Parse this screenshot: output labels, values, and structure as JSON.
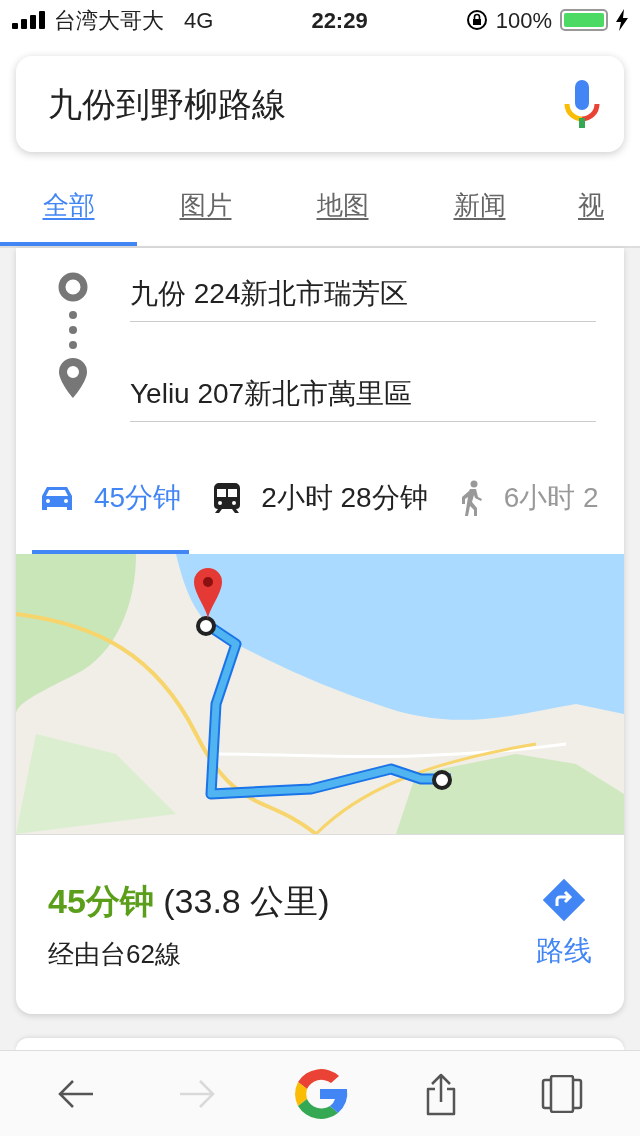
{
  "status_bar": {
    "carrier": "台湾大哥大",
    "network": "4G",
    "time": "22:29",
    "battery": "100%"
  },
  "search": {
    "value": "九份到野柳路線"
  },
  "tabs": [
    {
      "label": "全部",
      "selected": true
    },
    {
      "label": "图片",
      "selected": false
    },
    {
      "label": "地图",
      "selected": false
    },
    {
      "label": "新闻",
      "selected": false
    },
    {
      "label": "视",
      "selected": false
    }
  ],
  "route": {
    "origin": "九份 224新北市瑞芳区",
    "destination": "Yeliu 207新北市萬里區"
  },
  "modes": [
    {
      "kind": "car",
      "label": "45分钟",
      "selected": true
    },
    {
      "kind": "transit",
      "label": "2小时 28分钟",
      "selected": false
    },
    {
      "kind": "walk",
      "label": "6小时 2",
      "selected": false
    }
  ],
  "summary": {
    "duration": "45分钟",
    "distance": "(33.8 公里)",
    "via": "经由台62線",
    "directions_button": "路线"
  },
  "toolbar": [
    {
      "kind": "back",
      "disabled": false
    },
    {
      "kind": "forward",
      "disabled": true
    },
    {
      "kind": "google"
    },
    {
      "kind": "share",
      "disabled": false
    },
    {
      "kind": "tabs",
      "disabled": false
    }
  ]
}
